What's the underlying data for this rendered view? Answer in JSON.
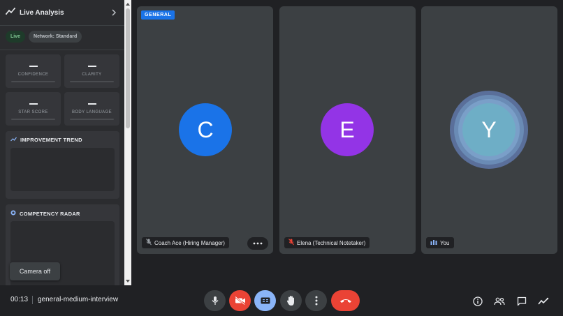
{
  "sidebar": {
    "title": "Live Analysis",
    "chips": {
      "live": "Live",
      "network": "Network: Standard"
    },
    "metrics": [
      {
        "label": "CONFIDENCE"
      },
      {
        "label": "CLARITY"
      },
      {
        "label": "STAR SCORE"
      },
      {
        "label": "BODY LANGUAGE"
      }
    ],
    "improvement_trend": {
      "title": "IMPROVEMENT TREND"
    },
    "competency_radar": {
      "title": "COMPETENCY RADAR"
    },
    "camera_off": "Camera off"
  },
  "tiles": [
    {
      "badge": "GENERAL",
      "initial": "C",
      "name": "Coach Ace (Hiring Manager)",
      "avatar_color": "#1a73e8"
    },
    {
      "initial": "E",
      "name": "Elena (Technical Notetaker)",
      "avatar_color": "#9334e6"
    },
    {
      "initial": "Y",
      "name": "You",
      "avatar_color": "#6eaec6"
    }
  ],
  "bottom": {
    "time": "00:13",
    "meeting_name": "general-medium-interview"
  },
  "colors": {
    "hangup": "#ea4335",
    "camera_off": "#ea4335",
    "captions": "#8ab4f8",
    "live": "#81c995"
  }
}
